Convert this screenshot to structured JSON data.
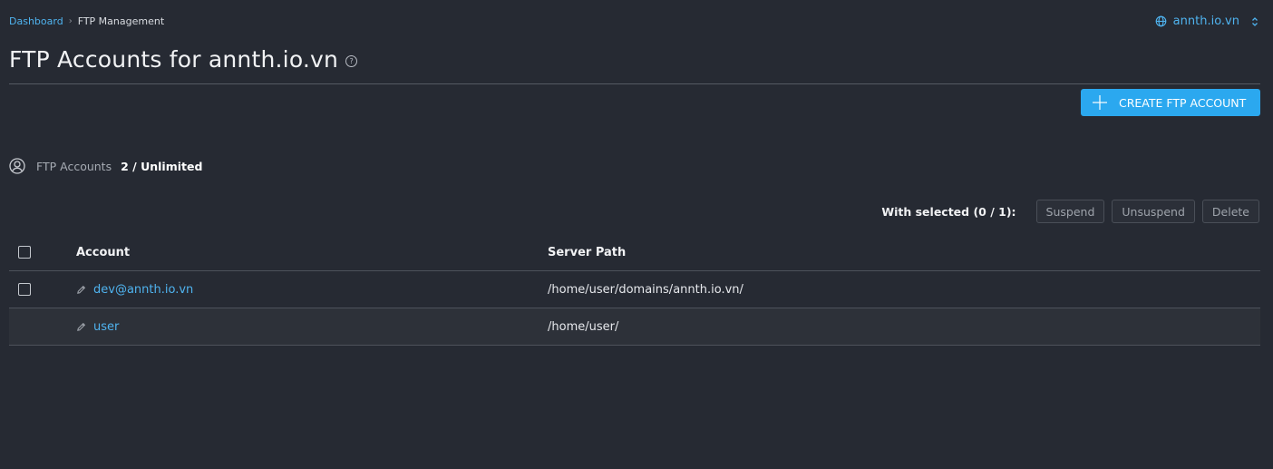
{
  "breadcrumb": {
    "home": "Dashboard",
    "separator": "›",
    "current": "FTP Management"
  },
  "domain_selector": {
    "value": "annth.io.vn",
    "icon": "globe-icon",
    "chevron": "⌃⌄"
  },
  "header": {
    "title": "FTP Accounts for annth.io.vn",
    "help": "?"
  },
  "actions": {
    "create_label": "CREATE FTP ACCOUNT"
  },
  "usage": {
    "label": "FTP Accounts",
    "value": "2 / Unlimited"
  },
  "bulk": {
    "label": "With selected (0 / 1):",
    "buttons": [
      "Suspend",
      "Unsuspend",
      "Delete"
    ]
  },
  "table": {
    "columns": [
      "Account",
      "Server Path"
    ],
    "rows": [
      {
        "account": "dev@annth.io.vn",
        "path": "/home/user/domains/annth.io.vn/",
        "selectable": true
      },
      {
        "account": "user",
        "path": "/home/user/",
        "selectable": false
      }
    ]
  },
  "colors": {
    "background": "#262a33",
    "accent": "#2ba8ef",
    "link": "#4fb3ef"
  }
}
